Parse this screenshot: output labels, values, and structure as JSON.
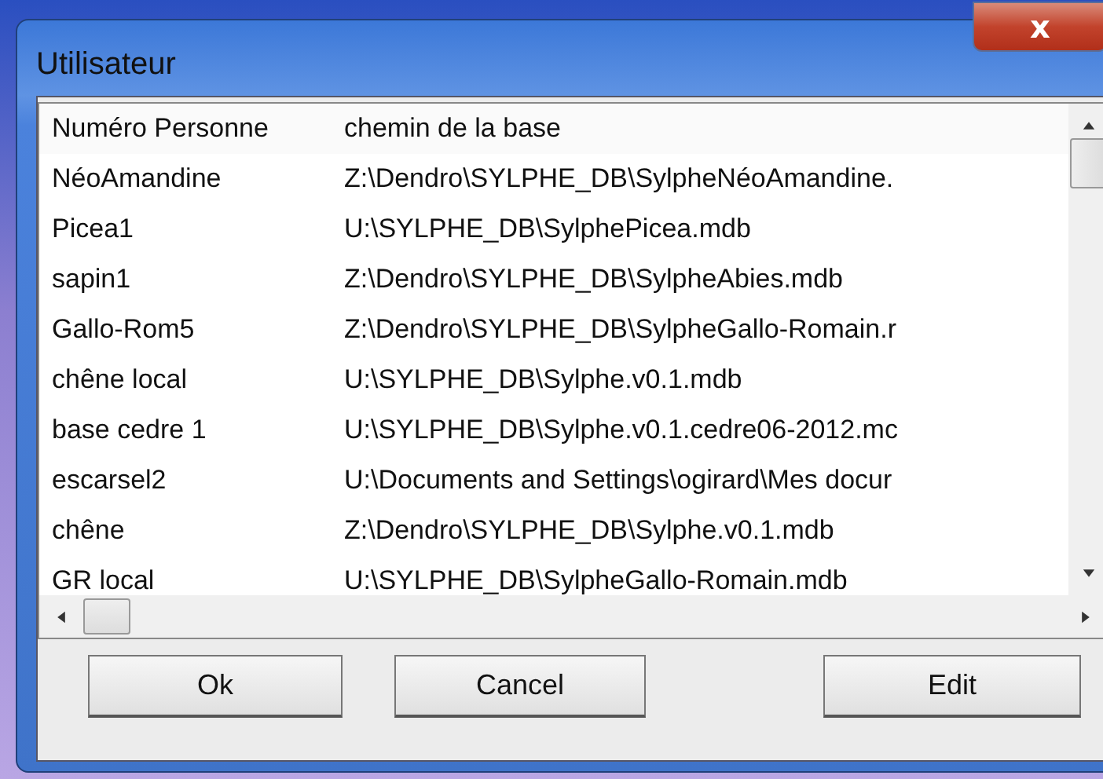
{
  "window": {
    "title": "Utilisateur",
    "close": "x"
  },
  "table": {
    "columns": [
      "Numéro Personne",
      "chemin de la base"
    ],
    "rows": [
      [
        "NéoAmandine",
        "Z:\\Dendro\\SYLPHE_DB\\SylpheNéoAmandine."
      ],
      [
        "Picea1",
        "U:\\SYLPHE_DB\\SylphePicea.mdb"
      ],
      [
        "sapin1",
        "Z:\\Dendro\\SYLPHE_DB\\SylpheAbies.mdb"
      ],
      [
        "Gallo-Rom5",
        "Z:\\Dendro\\SYLPHE_DB\\SylpheGallo-Romain.r"
      ],
      [
        "chêne local",
        "U:\\SYLPHE_DB\\Sylphe.v0.1.mdb"
      ],
      [
        "base cedre 1",
        "U:\\SYLPHE_DB\\Sylphe.v0.1.cedre06-2012.mc"
      ],
      [
        "escarsel2",
        "U:\\Documents and Settings\\ogirard\\Mes docur"
      ],
      [
        "chêne",
        "Z:\\Dendro\\SYLPHE_DB\\Sylphe.v0.1.mdb"
      ],
      [
        "GR local",
        "U:\\SYLPHE_DB\\SylpheGallo-Romain.mdb"
      ]
    ]
  },
  "buttons": [
    "Ok",
    "Cancel",
    "Edit"
  ]
}
